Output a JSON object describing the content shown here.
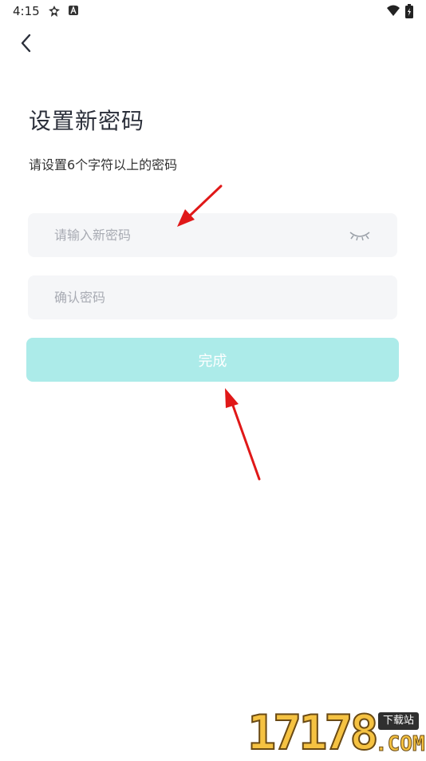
{
  "status_bar": {
    "time": "4:15",
    "status_icons": [
      "sync-icon",
      "a-notification-icon"
    ],
    "wifi_icon": "wifi-icon",
    "battery_icon": "battery-charging-icon"
  },
  "header": {
    "back_icon": "chevron-left-icon"
  },
  "title": "设置新密码",
  "subtitle": "请设置6个字符以上的密码",
  "form": {
    "new_password_placeholder": "请输入新密码",
    "new_password_value": "",
    "confirm_password_placeholder": "确认密码",
    "confirm_password_value": "",
    "visibility_icon": "eye-closed-icon",
    "submit_label": "完成"
  },
  "colors": {
    "accent_button": "#acebe9",
    "input_bg": "#f5f6f8",
    "annotation": "#e01818"
  },
  "watermark": {
    "digits": "17178",
    "badge": "下载站",
    "suffix": ".COM"
  }
}
